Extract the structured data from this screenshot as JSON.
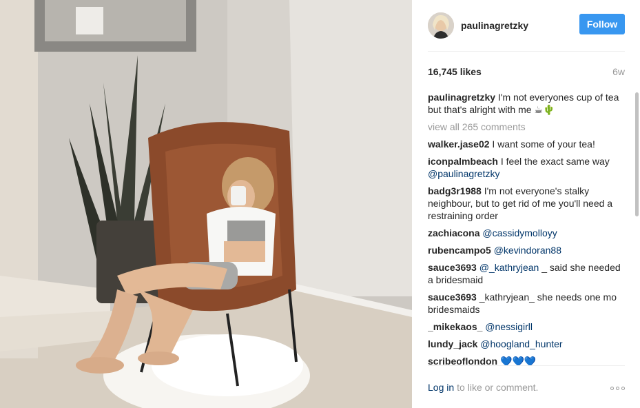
{
  "post": {
    "username": "paulinagretzky",
    "follow_label": "Follow",
    "likes": "16,745 likes",
    "age": "6w",
    "caption": {
      "user": "paulinagretzky",
      "text": "I'm not everyones cup of tea but that's alright with me ☕🌵"
    },
    "view_all": "view all 265 comments",
    "comments": [
      {
        "user": "walker.jase02",
        "text": "I want some of your tea!",
        "mention": "",
        "after": ""
      },
      {
        "user": "iconpalmbeach",
        "text": "I feel the exact same way",
        "mention": "@paulinagretzky",
        "after": ""
      },
      {
        "user": "badg3r1988",
        "text": "I'm not everyone's stalky neighbour, but to get rid of me you'll need a restraining order",
        "mention": "",
        "after": ""
      },
      {
        "user": "zachiacona",
        "text": "",
        "mention": "@cassidymolloyy",
        "after": ""
      },
      {
        "user": "rubencampo5",
        "text": "",
        "mention": "@kevindoran88",
        "after": ""
      },
      {
        "user": "sauce3693",
        "text": "",
        "mention": "@_kathryjean",
        "after": "_ said she needed a bridesmaid"
      },
      {
        "user": "sauce3693",
        "text": "_kathryjean_ she needs one mo bridesmaids",
        "mention": "",
        "after": ""
      },
      {
        "user": "_mikekaos_",
        "text": "",
        "mention": "@nessigirll",
        "after": ""
      },
      {
        "user": "lundy_jack",
        "text": "",
        "mention": "@hoogland_hunter",
        "after": ""
      },
      {
        "user": "scribeoflondon",
        "text": "💙💙💙",
        "mention": "",
        "after": ""
      }
    ],
    "footer": {
      "login_label": "Log in",
      "rest": "to like or comment."
    }
  },
  "colors": {
    "follow_bg": "#3897f0",
    "mention": "#003569",
    "muted": "#999999"
  },
  "icons": {
    "more": "more-options-icon"
  }
}
